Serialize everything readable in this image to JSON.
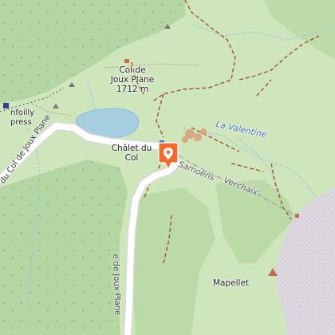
{
  "map": {
    "labels": {
      "col_name_1": "Col de",
      "col_name_2": "Joux Plane",
      "col_elev": "1712 m",
      "chalet_1": "Châlet du",
      "chalet_2": "Col",
      "valentine": "La Valentine",
      "samoens": "Samoëns",
      "verchaix": "Verchaix",
      "mapellet": "Mapellet",
      "road_left": "du Col de Joux Plane",
      "road_bottom": "e de Joux Plane",
      "lift_1": "nfoilly",
      "lift_2": "press"
    },
    "marker": {
      "name": "location-pin",
      "color": "#f26a2e"
    },
    "colors": {
      "meadow": "#cfe6bd",
      "forest": "#b3d6a2",
      "rock": "#ddd7df",
      "lake": "#a6cde0",
      "road": "#ffffff",
      "path": "#a0522d"
    }
  }
}
